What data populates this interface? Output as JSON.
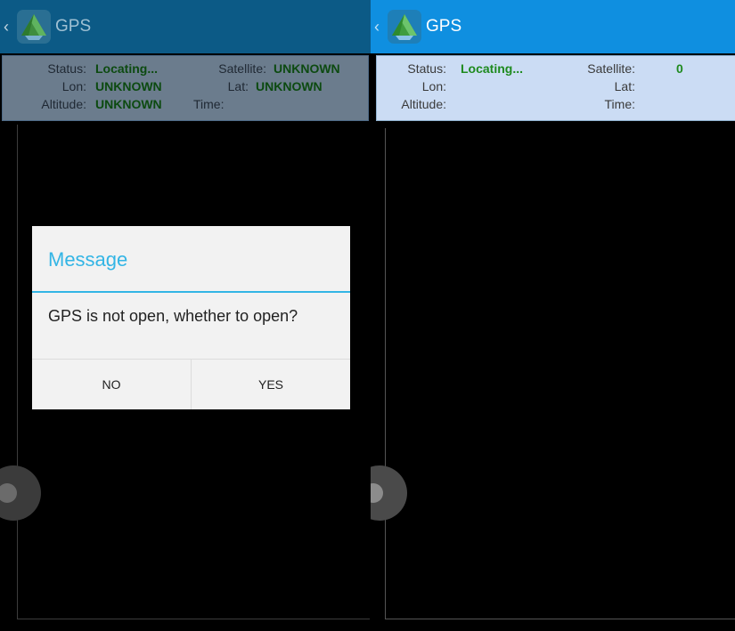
{
  "colors": {
    "appbar_left": "#0c5a86",
    "appbar_right": "#0f8fe0",
    "accent": "#33b5e5",
    "value_green": "#1e8a1e"
  },
  "left": {
    "app_title": "GPS",
    "status_label": "Status:",
    "status_value": "Locating...",
    "satellite_label": "Satellite:",
    "satellite_value": "UNKNOWN",
    "lon_label": "Lon:",
    "lon_value": "UNKNOWN",
    "lat_label": "Lat:",
    "lat_value": "UNKNOWN",
    "altitude_label": "Altitude:",
    "altitude_value": "UNKNOWN",
    "time_label": "Time:",
    "time_value": ""
  },
  "right": {
    "app_title": "GPS",
    "status_label": "Status:",
    "status_value": "Locating...",
    "satellite_label": "Satellite:",
    "satellite_value": "0",
    "lon_label": "Lon:",
    "lon_value": "",
    "lat_label": "Lat:",
    "lat_value": "",
    "altitude_label": "Altitude:",
    "altitude_value": "",
    "time_label": "Time:",
    "time_value": ""
  },
  "dialog": {
    "title": "Message",
    "message": "GPS is not open, whether to open?",
    "no_label": "NO",
    "yes_label": "YES"
  }
}
